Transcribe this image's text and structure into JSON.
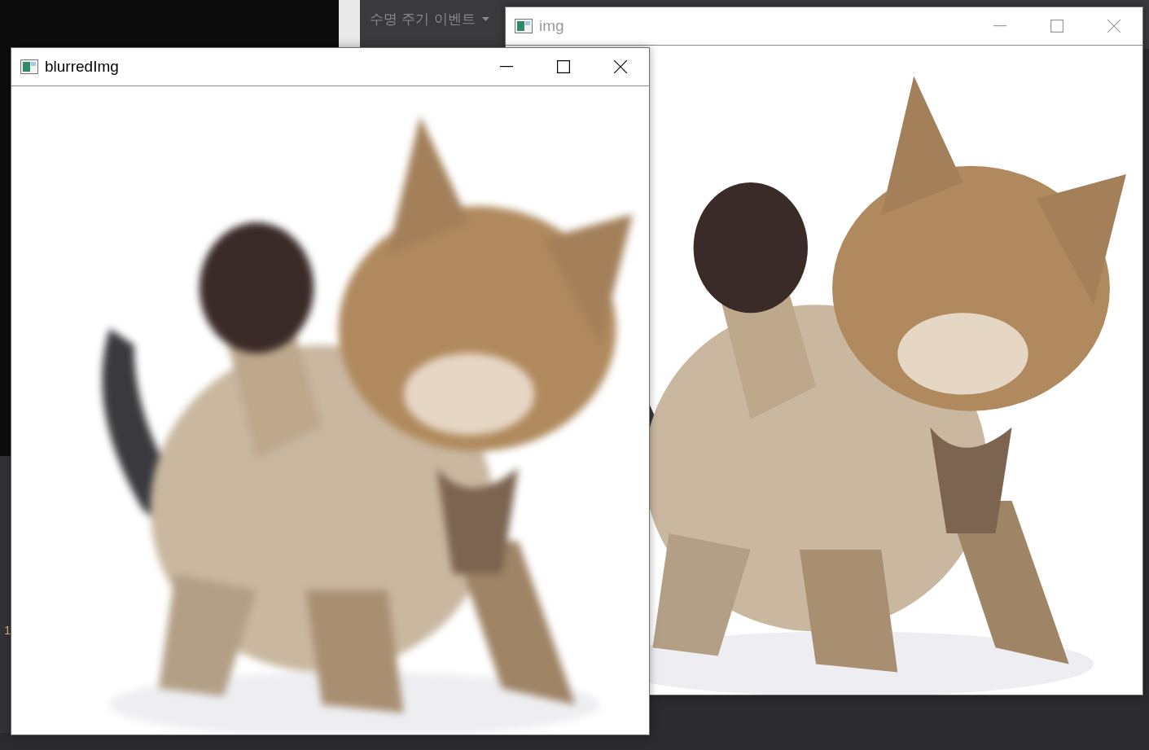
{
  "ide": {
    "dropdown": {
      "label": "수명 주기 이벤트"
    },
    "line_number": "1"
  },
  "windows": [
    {
      "title": "img",
      "active": false,
      "blurred": false
    },
    {
      "title": "blurredImg",
      "active": true,
      "blurred": true
    }
  ]
}
